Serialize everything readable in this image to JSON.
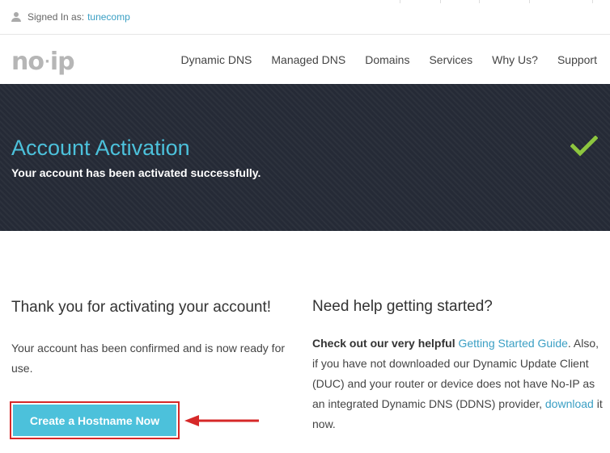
{
  "topbar": {
    "signed_in_label": "Signed In as:",
    "username": "tunecomp"
  },
  "logo": {
    "left": "no",
    "dot": "·",
    "right": "ip"
  },
  "nav": {
    "items": [
      {
        "label": "Dynamic DNS"
      },
      {
        "label": "Managed DNS"
      },
      {
        "label": "Domains"
      },
      {
        "label": "Services"
      },
      {
        "label": "Why Us?"
      },
      {
        "label": "Support"
      }
    ]
  },
  "hero": {
    "title": "Account Activation",
    "subtitle": "Your account has been activated successfully.",
    "check_icon": "check-icon",
    "accent_color": "#4cc1db",
    "check_color": "#8dc63f"
  },
  "left": {
    "heading": "Thank you for activating your account!",
    "body": "Your account has been confirmed and is now ready for use.",
    "button_label": "Create a Hostname Now"
  },
  "right": {
    "heading": "Need help getting started?",
    "intro": "Check out our very helpful",
    "guide_link": "Getting Started Guide",
    "guide_suffix": ".",
    "body1": "Also, if you have not downloaded our Dynamic Update Client (DUC) and your router or device does not have No-IP as an integrated Dynamic DNS (DDNS) provider,",
    "download_link": "download",
    "body2": "it now."
  }
}
